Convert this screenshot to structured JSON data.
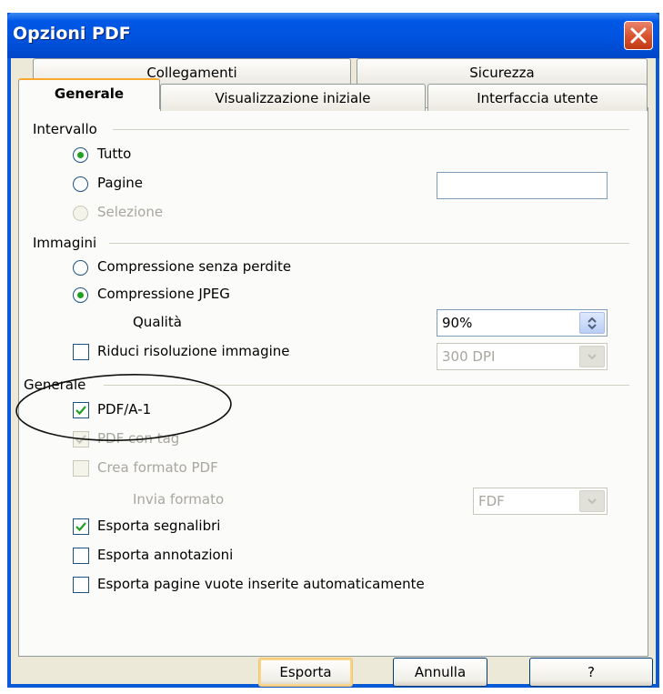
{
  "window": {
    "title": "Opzioni PDF"
  },
  "tabs": {
    "row1": [
      "Collegamenti",
      "Sicurezza"
    ],
    "row2": [
      "Generale",
      "Visualizzazione iniziale",
      "Interfaccia utente"
    ],
    "active": "Generale"
  },
  "intervallo": {
    "label": "Intervallo",
    "options": [
      {
        "label": "Tutto",
        "checked": true,
        "enabled": true
      },
      {
        "label": "Pagine",
        "checked": false,
        "enabled": true
      },
      {
        "label": "Selezione",
        "checked": false,
        "enabled": false
      }
    ],
    "pages_value": ""
  },
  "immagini": {
    "label": "Immagini",
    "options": [
      {
        "label": "Compressione senza perdite",
        "checked": false
      },
      {
        "label": "Compressione JPEG",
        "checked": true
      }
    ],
    "quality_label": "Qualità",
    "quality_value": "90%",
    "reduce_label": "Riduci risoluzione immagine",
    "reduce_checked": false,
    "resolution_value": "300 DPI"
  },
  "generale": {
    "label": "Generale",
    "checks": [
      {
        "label": "PDF/A-1",
        "checked": true,
        "enabled": true
      },
      {
        "label": "PDF con tag",
        "checked": true,
        "enabled": false
      },
      {
        "label": "Crea formato PDF",
        "checked": false,
        "enabled": false
      }
    ],
    "send_format_label": "Invia formato",
    "send_format_value": "FDF",
    "exports": [
      {
        "label": "Esporta segnalibri",
        "checked": true
      },
      {
        "label": "Esporta annotazioni",
        "checked": false
      },
      {
        "label": "Esporta pagine vuote inserite automaticamente",
        "checked": false
      }
    ]
  },
  "buttons": {
    "export": "Esporta",
    "cancel": "Annulla",
    "help": "?"
  },
  "colors": {
    "titlebar": "#0058e6",
    "face": "#ece9d8",
    "check_green": "#21a121",
    "close_red": "#d8512c"
  }
}
